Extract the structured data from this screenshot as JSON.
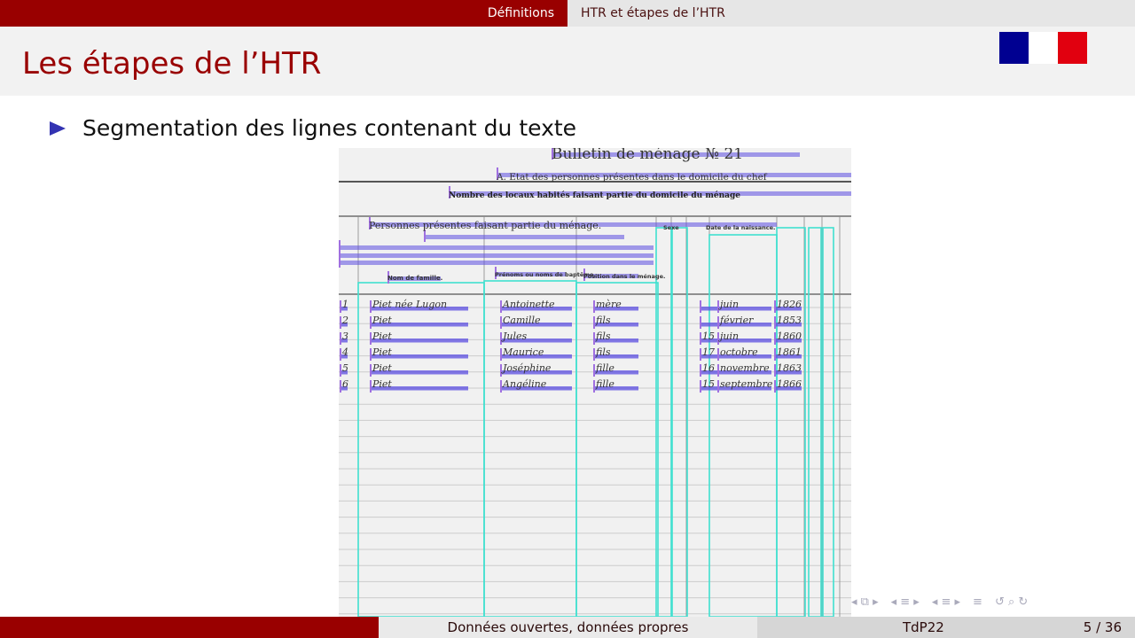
{
  "header": {
    "section": "Définitions",
    "subsection": "HTR et étapes de l’HTR"
  },
  "slide": {
    "title": "Les étapes de l’HTR",
    "bullets": [
      "Segmentation des lignes contenant du texte"
    ]
  },
  "scan": {
    "heading": "Bulletin de ménage № 21",
    "subheading": "A. Etat des personnes présentes dans le domicile du chef",
    "line3": "Nombre des locaux habités faisant partie du domicile du ménage",
    "section": "Personnes présentes faisant partie du ménage.",
    "columns": [
      "Nom de famille.",
      "Prénoms ou noms de baptême.",
      "Position dans le ménage.",
      "Sexe",
      "Date de la naissance."
    ],
    "rows": [
      [
        "1",
        "Piet née Lugon",
        "Antoinette",
        "mère",
        "",
        "juin",
        "1826"
      ],
      [
        "2",
        "Piet",
        "Camille",
        "fils",
        "",
        "février",
        "1853"
      ],
      [
        "3",
        "Piet",
        "Jules",
        "fils",
        "15",
        "juin",
        "1860"
      ],
      [
        "4",
        "Piet",
        "Maurice",
        "fils",
        "17",
        "octobre",
        "1861"
      ],
      [
        "5",
        "Piet",
        "Joséphine",
        "fille",
        "16",
        "novembre",
        "1863"
      ],
      [
        "6",
        "Piet",
        "Angéline",
        "fille",
        "15",
        "septembre",
        "1866"
      ]
    ],
    "colors": {
      "line_box": "#5b4de0",
      "region": "#40e0d0"
    }
  },
  "footer": {
    "left": "",
    "center": "Données ouvertes, données propres",
    "right_label": "TdP22",
    "page": "5 / 36"
  },
  "nav_icons": [
    "frame-icon",
    "section-icon",
    "subsection-icon",
    "toc-icon",
    "back-icon",
    "search-icon",
    "forward-icon"
  ],
  "colors": {
    "brand": "#990000",
    "bullet": "#3333b2"
  }
}
